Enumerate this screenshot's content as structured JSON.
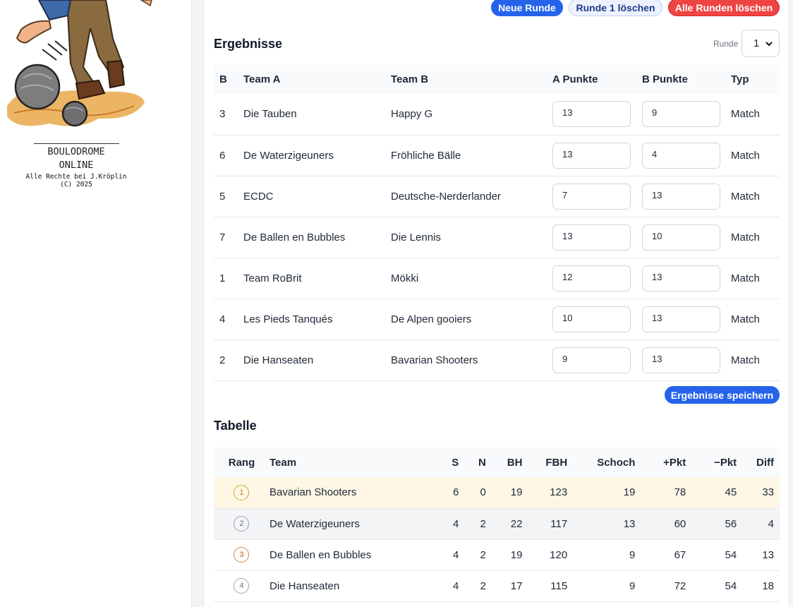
{
  "brand": {
    "name_line1": "BOULODROME",
    "name_line2": "ONLINE",
    "copyright_line1": "Alle Rechte bei J.Kröplin",
    "copyright_line2": "(C) 2025"
  },
  "toolbar": {
    "new_round": "Neue Runde",
    "delete_round": "Runde 1 löschen",
    "delete_all": "Alle Runden löschen"
  },
  "results": {
    "title": "Ergebnisse",
    "round_label": "Runde",
    "round_value": "1",
    "headers": [
      "B",
      "Team A",
      "Team B",
      "A Punkte",
      "B Punkte",
      "Typ"
    ],
    "rows": [
      {
        "b": "3",
        "team_a": "Die Tauben",
        "team_b": "Happy G",
        "a": "13",
        "bp": "9",
        "typ": "Match"
      },
      {
        "b": "6",
        "team_a": "De Waterzigeuners",
        "team_b": "Fröhliche Bälle",
        "a": "13",
        "bp": "4",
        "typ": "Match"
      },
      {
        "b": "5",
        "team_a": "ECDC",
        "team_b": "Deutsche-Nerderlander",
        "a": "7",
        "bp": "13",
        "typ": "Match"
      },
      {
        "b": "7",
        "team_a": "De Ballen en Bubbles",
        "team_b": "Die Lennis",
        "a": "13",
        "bp": "10",
        "typ": "Match"
      },
      {
        "b": "1",
        "team_a": "Team RoBrit",
        "team_b": "Mökki",
        "a": "12",
        "bp": "13",
        "typ": "Match"
      },
      {
        "b": "4",
        "team_a": "Les Pieds Tanqués",
        "team_b": "De Alpen gooiers",
        "a": "10",
        "bp": "13",
        "typ": "Match"
      },
      {
        "b": "2",
        "team_a": "Die Hanseaten",
        "team_b": "Bavarian Shooters",
        "a": "9",
        "bp": "13",
        "typ": "Match"
      }
    ],
    "save_label": "Ergebnisse speichern"
  },
  "standings": {
    "title": "Tabelle",
    "headers": [
      "Rang",
      "Team",
      "S",
      "N",
      "BH",
      "FBH",
      "Schoch",
      "+Pkt",
      "−Pkt",
      "Diff"
    ],
    "rows": [
      {
        "rang": "1",
        "team": "Bavarian Shooters",
        "s": "6",
        "n": "0",
        "bh": "19",
        "fbh": "123",
        "schoch": "19",
        "plus": "78",
        "minus": "45",
        "diff": "33"
      },
      {
        "rang": "2",
        "team": "De Waterzigeuners",
        "s": "4",
        "n": "2",
        "bh": "22",
        "fbh": "117",
        "schoch": "13",
        "plus": "60",
        "minus": "56",
        "diff": "4"
      },
      {
        "rang": "3",
        "team": "De Ballen en Bubbles",
        "s": "4",
        "n": "2",
        "bh": "19",
        "fbh": "120",
        "schoch": "9",
        "plus": "67",
        "minus": "54",
        "diff": "13"
      },
      {
        "rang": "4",
        "team": "Die Hanseaten",
        "s": "4",
        "n": "2",
        "bh": "17",
        "fbh": "115",
        "schoch": "9",
        "plus": "72",
        "minus": "54",
        "diff": "18"
      }
    ]
  },
  "colors": {
    "primary": "#2563eb",
    "danger": "#ef4444",
    "first_place_row": "#fef7e6"
  }
}
